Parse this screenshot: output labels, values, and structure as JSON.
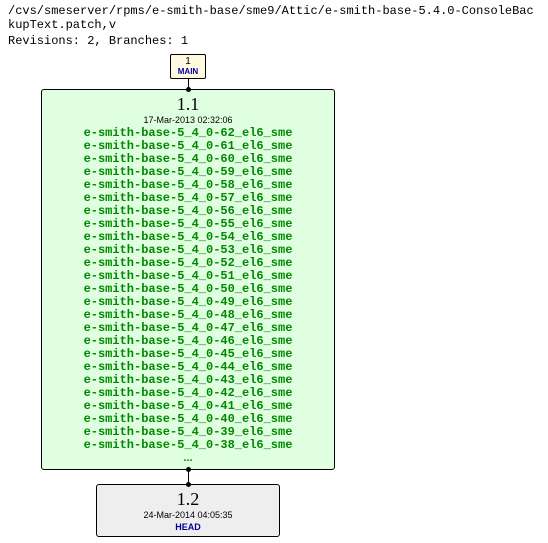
{
  "header": {
    "path": "/cvs/smeserver/rpms/e-smith-base/sme9/Attic/e-smith-base-5.4.0-ConsoleBackupText.patch,v",
    "meta": "Revisions: 2, Branches: 1"
  },
  "branch_badge": {
    "num": "1",
    "label": "MAIN"
  },
  "rev1": {
    "version": "1.1",
    "date": "17-Mar-2013 02:32:06",
    "tags": [
      "e-smith-base-5_4_0-62_el6_sme",
      "e-smith-base-5_4_0-61_el6_sme",
      "e-smith-base-5_4_0-60_el6_sme",
      "e-smith-base-5_4_0-59_el6_sme",
      "e-smith-base-5_4_0-58_el6_sme",
      "e-smith-base-5_4_0-57_el6_sme",
      "e-smith-base-5_4_0-56_el6_sme",
      "e-smith-base-5_4_0-55_el6_sme",
      "e-smith-base-5_4_0-54_el6_sme",
      "e-smith-base-5_4_0-53_el6_sme",
      "e-smith-base-5_4_0-52_el6_sme",
      "e-smith-base-5_4_0-51_el6_sme",
      "e-smith-base-5_4_0-50_el6_sme",
      "e-smith-base-5_4_0-49_el6_sme",
      "e-smith-base-5_4_0-48_el6_sme",
      "e-smith-base-5_4_0-47_el6_sme",
      "e-smith-base-5_4_0-46_el6_sme",
      "e-smith-base-5_4_0-45_el6_sme",
      "e-smith-base-5_4_0-44_el6_sme",
      "e-smith-base-5_4_0-43_el6_sme",
      "e-smith-base-5_4_0-42_el6_sme",
      "e-smith-base-5_4_0-41_el6_sme",
      "e-smith-base-5_4_0-40_el6_sme",
      "e-smith-base-5_4_0-39_el6_sme",
      "e-smith-base-5_4_0-38_el6_sme"
    ],
    "more": "..."
  },
  "rev2": {
    "version": "1.2",
    "date": "24-Mar-2014 04:05:35",
    "head": "HEAD"
  }
}
